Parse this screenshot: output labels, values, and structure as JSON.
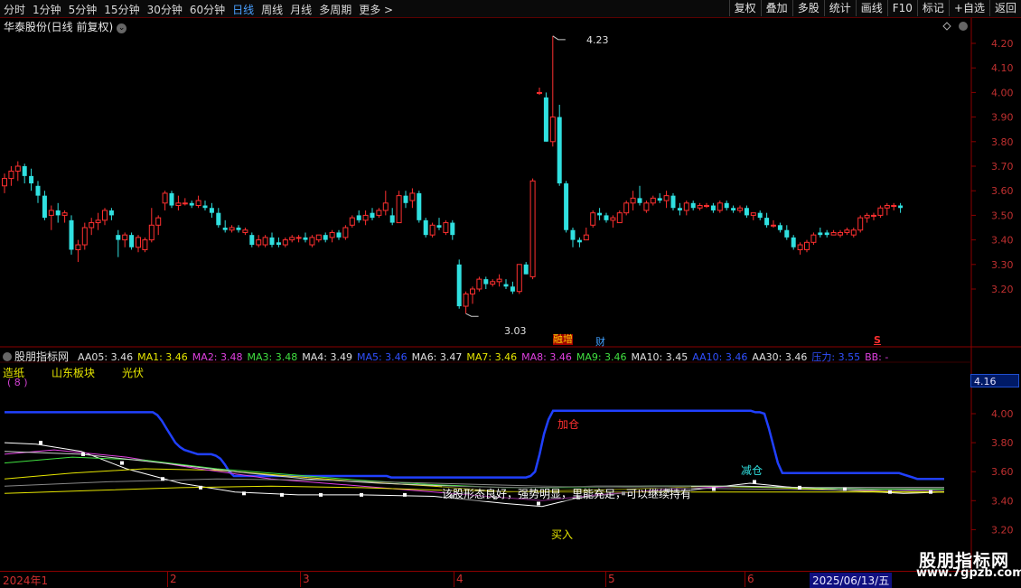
{
  "toolbar": {
    "periods": [
      "分时",
      "1分钟",
      "5分钟",
      "15分钟",
      "30分钟",
      "60分钟",
      "日线",
      "周线",
      "月线",
      "多周期",
      "更多 >"
    ],
    "active": "日线",
    "actions": [
      "复权",
      "叠加",
      "多股",
      "统计",
      "画线",
      "F10",
      "标记",
      "+自选",
      "返回"
    ]
  },
  "title": "华泰股份(日线 前复权)",
  "price_chart": {
    "high_label": "4.23",
    "low_label": "3.03",
    "badge1": "融增",
    "badge2": "财",
    "badge3": "S",
    "axis_ticks": [
      "4.20",
      "4.10",
      "4.00",
      "3.90",
      "3.80",
      "3.70",
      "3.60",
      "3.50",
      "3.40",
      "3.30",
      "3.20"
    ],
    "ohlc": [
      [
        3.62,
        3.67,
        3.59,
        3.65
      ],
      [
        3.65,
        3.7,
        3.62,
        3.68
      ],
      [
        3.68,
        3.72,
        3.64,
        3.7
      ],
      [
        3.7,
        3.71,
        3.63,
        3.66
      ],
      [
        3.66,
        3.69,
        3.6,
        3.63
      ],
      [
        3.62,
        3.64,
        3.55,
        3.58
      ],
      [
        3.58,
        3.6,
        3.48,
        3.49
      ],
      [
        3.5,
        3.54,
        3.44,
        3.52
      ],
      [
        3.52,
        3.55,
        3.47,
        3.5
      ],
      [
        3.5,
        3.52,
        3.47,
        3.51
      ],
      [
        3.48,
        3.5,
        3.34,
        3.36
      ],
      [
        3.36,
        3.4,
        3.31,
        3.38
      ],
      [
        3.38,
        3.47,
        3.36,
        3.45
      ],
      [
        3.45,
        3.49,
        3.42,
        3.47
      ],
      [
        3.47,
        3.51,
        3.44,
        3.48
      ],
      [
        3.48,
        3.53,
        3.46,
        3.52
      ],
      [
        3.52,
        3.53,
        3.48,
        3.5
      ],
      [
        3.42,
        3.44,
        3.33,
        3.4
      ],
      [
        3.4,
        3.43,
        3.37,
        3.42
      ],
      [
        3.42,
        3.43,
        3.36,
        3.37
      ],
      [
        3.37,
        3.42,
        3.35,
        3.41
      ],
      [
        3.36,
        3.41,
        3.35,
        3.4
      ],
      [
        3.4,
        3.53,
        3.39,
        3.46
      ],
      [
        3.46,
        3.5,
        3.42,
        3.49
      ],
      [
        3.55,
        3.6,
        3.52,
        3.59
      ],
      [
        3.59,
        3.6,
        3.53,
        3.54
      ],
      [
        3.54,
        3.58,
        3.52,
        3.55
      ],
      [
        3.55,
        3.57,
        3.54,
        3.55
      ],
      [
        3.55,
        3.56,
        3.53,
        3.54
      ],
      [
        3.54,
        3.58,
        3.53,
        3.56
      ],
      [
        3.54,
        3.56,
        3.52,
        3.53
      ],
      [
        3.53,
        3.55,
        3.49,
        3.51
      ],
      [
        3.51,
        3.53,
        3.45,
        3.46
      ],
      [
        3.45,
        3.48,
        3.43,
        3.44
      ],
      [
        3.44,
        3.46,
        3.43,
        3.45
      ],
      [
        3.45,
        3.46,
        3.43,
        3.44
      ],
      [
        3.43,
        3.45,
        3.42,
        3.44
      ],
      [
        3.42,
        3.43,
        3.37,
        3.38
      ],
      [
        3.38,
        3.42,
        3.37,
        3.4
      ],
      [
        3.38,
        3.42,
        3.37,
        3.41
      ],
      [
        3.41,
        3.43,
        3.37,
        3.38
      ],
      [
        3.39,
        3.41,
        3.37,
        3.38
      ],
      [
        3.38,
        3.41,
        3.37,
        3.4
      ],
      [
        3.4,
        3.42,
        3.39,
        3.41
      ],
      [
        3.41,
        3.42,
        3.39,
        3.41
      ],
      [
        3.41,
        3.43,
        3.39,
        3.4
      ],
      [
        3.38,
        3.42,
        3.37,
        3.41
      ],
      [
        3.4,
        3.42,
        3.39,
        3.42
      ],
      [
        3.42,
        3.43,
        3.39,
        3.4
      ],
      [
        3.41,
        3.44,
        3.39,
        3.43
      ],
      [
        3.43,
        3.44,
        3.4,
        3.41
      ],
      [
        3.41,
        3.46,
        3.4,
        3.45
      ],
      [
        3.46,
        3.5,
        3.45,
        3.49
      ],
      [
        3.5,
        3.52,
        3.47,
        3.48
      ],
      [
        3.48,
        3.52,
        3.46,
        3.5
      ],
      [
        3.51,
        3.53,
        3.48,
        3.49
      ],
      [
        3.5,
        3.53,
        3.49,
        3.52
      ],
      [
        3.52,
        3.6,
        3.5,
        3.55
      ],
      [
        3.5,
        3.53,
        3.46,
        3.47
      ],
      [
        3.47,
        3.6,
        3.47,
        3.58
      ],
      [
        3.58,
        3.6,
        3.53,
        3.55
      ],
      [
        3.56,
        3.61,
        3.53,
        3.59
      ],
      [
        3.59,
        3.6,
        3.47,
        3.48
      ],
      [
        3.48,
        3.49,
        3.41,
        3.42
      ],
      [
        3.42,
        3.47,
        3.41,
        3.46
      ],
      [
        3.46,
        3.49,
        3.44,
        3.45
      ],
      [
        3.43,
        3.48,
        3.42,
        3.47
      ],
      [
        3.47,
        3.48,
        3.4,
        3.42
      ],
      [
        3.3,
        3.32,
        3.12,
        3.13
      ],
      [
        3.13,
        3.19,
        3.1,
        3.18
      ],
      [
        3.18,
        3.21,
        3.14,
        3.2
      ],
      [
        3.2,
        3.25,
        3.19,
        3.24
      ],
      [
        3.24,
        3.25,
        3.2,
        3.22
      ],
      [
        3.22,
        3.24,
        3.21,
        3.23
      ],
      [
        3.23,
        3.26,
        3.21,
        3.24
      ],
      [
        3.22,
        3.24,
        3.2,
        3.21
      ],
      [
        3.21,
        3.23,
        3.18,
        3.19
      ],
      [
        3.19,
        3.3,
        3.18,
        3.3
      ],
      [
        3.3,
        3.31,
        3.26,
        3.26
      ],
      [
        3.25,
        3.65,
        3.24,
        3.64
      ],
      [
        4.0,
        4.02,
        3.99,
        4.0
      ],
      [
        3.98,
        4.0,
        3.8,
        3.8
      ],
      [
        3.8,
        4.23,
        3.78,
        3.9
      ],
      [
        3.9,
        3.95,
        3.62,
        3.63
      ],
      [
        3.63,
        3.64,
        3.43,
        3.44
      ],
      [
        3.44,
        3.45,
        3.37,
        3.4
      ],
      [
        3.4,
        3.41,
        3.37,
        3.39
      ],
      [
        3.4,
        3.45,
        3.4,
        3.42
      ],
      [
        3.46,
        3.52,
        3.45,
        3.51
      ],
      [
        3.51,
        3.53,
        3.48,
        3.5
      ],
      [
        3.5,
        3.51,
        3.47,
        3.48
      ],
      [
        3.48,
        3.5,
        3.45,
        3.49
      ],
      [
        3.47,
        3.52,
        3.47,
        3.51
      ],
      [
        3.51,
        3.56,
        3.5,
        3.55
      ],
      [
        3.55,
        3.6,
        3.52,
        3.57
      ],
      [
        3.57,
        3.62,
        3.54,
        3.55
      ],
      [
        3.52,
        3.56,
        3.51,
        3.55
      ],
      [
        3.55,
        3.58,
        3.54,
        3.57
      ],
      [
        3.57,
        3.59,
        3.55,
        3.56
      ],
      [
        3.56,
        3.6,
        3.53,
        3.58
      ],
      [
        3.58,
        3.59,
        3.52,
        3.53
      ],
      [
        3.53,
        3.55,
        3.5,
        3.52
      ],
      [
        3.52,
        3.56,
        3.5,
        3.55
      ],
      [
        3.55,
        3.56,
        3.52,
        3.53
      ],
      [
        3.53,
        3.55,
        3.52,
        3.54
      ],
      [
        3.54,
        3.55,
        3.53,
        3.54
      ],
      [
        3.54,
        3.55,
        3.51,
        3.52
      ],
      [
        3.52,
        3.56,
        3.51,
        3.55
      ],
      [
        3.55,
        3.56,
        3.52,
        3.53
      ],
      [
        3.53,
        3.54,
        3.51,
        3.52
      ],
      [
        3.52,
        3.54,
        3.51,
        3.53
      ],
      [
        3.53,
        3.54,
        3.49,
        3.5
      ],
      [
        3.5,
        3.51,
        3.48,
        3.51
      ],
      [
        3.51,
        3.52,
        3.48,
        3.49
      ],
      [
        3.49,
        3.51,
        3.45,
        3.46
      ],
      [
        3.46,
        3.48,
        3.45,
        3.46
      ],
      [
        3.46,
        3.47,
        3.43,
        3.44
      ],
      [
        3.44,
        3.46,
        3.4,
        3.41
      ],
      [
        3.41,
        3.42,
        3.36,
        3.37
      ],
      [
        3.36,
        3.39,
        3.34,
        3.38
      ],
      [
        3.36,
        3.4,
        3.35,
        3.39
      ],
      [
        3.39,
        3.43,
        3.38,
        3.42
      ],
      [
        3.43,
        3.45,
        3.41,
        3.42
      ],
      [
        3.43,
        3.44,
        3.41,
        3.42
      ],
      [
        3.42,
        3.44,
        3.42,
        3.43
      ],
      [
        3.42,
        3.44,
        3.41,
        3.43
      ],
      [
        3.43,
        3.45,
        3.42,
        3.44
      ],
      [
        3.42,
        3.45,
        3.41,
        3.44
      ],
      [
        3.44,
        3.5,
        3.43,
        3.49
      ],
      [
        3.49,
        3.51,
        3.47,
        3.5
      ],
      [
        3.5,
        3.51,
        3.48,
        3.5
      ],
      [
        3.5,
        3.54,
        3.49,
        3.53
      ],
      [
        3.53,
        3.55,
        3.5,
        3.54
      ],
      [
        3.54,
        3.55,
        3.52,
        3.54
      ],
      [
        3.54,
        3.55,
        3.51,
        3.53
      ]
    ]
  },
  "indicator_bar": {
    "name": "股朋指标网",
    "items": [
      {
        "text": "AA05: 3.46",
        "color": "#e0e0e0"
      },
      {
        "text": "MA1: 3.46",
        "color": "#e6e600"
      },
      {
        "text": "MA2: 3.48",
        "color": "#e040e0"
      },
      {
        "text": "MA3: 3.48",
        "color": "#40e040"
      },
      {
        "text": "MA4: 3.49",
        "color": "#e0e0e0"
      },
      {
        "text": "MA5: 3.46",
        "color": "#3050ff"
      },
      {
        "text": "MA6: 3.47",
        "color": "#e0e0e0"
      },
      {
        "text": "MA7: 3.46",
        "color": "#e6e600"
      },
      {
        "text": "MA8: 3.46",
        "color": "#e040e0"
      },
      {
        "text": "MA9: 3.46",
        "color": "#40e040"
      },
      {
        "text": "MA10: 3.45",
        "color": "#e0e0e0"
      },
      {
        "text": "AA10: 3.46",
        "color": "#3050ff"
      },
      {
        "text": "AA30: 3.46",
        "color": "#e0e0e0"
      },
      {
        "text": "压力: 3.55",
        "color": "#3050ff"
      },
      {
        "text": "BB: -",
        "color": "#e040e0"
      }
    ]
  },
  "sub_panel": {
    "labels": [
      "造纸",
      "山东板块",
      "光伏"
    ],
    "count": "( 8 )",
    "marker": "4.16",
    "axis_ticks": [
      "4.00",
      "3.80",
      "3.60",
      "3.40",
      "3.20"
    ],
    "add_label": "加仓",
    "reduce_label": "减仓",
    "buy_label": "买入",
    "signal_text": "该股形态良好，强势明显，里能充足，可以继续持有",
    "pressure": [
      4.01,
      4.01,
      4.01,
      4.01,
      4.01,
      4.01,
      4.01,
      4.01,
      4.01,
      4.01,
      4.01,
      4.01,
      4.01,
      4.01,
      4.01,
      4.01,
      4.01,
      4.01,
      4.01,
      4.01,
      4.01,
      4.01,
      4.01,
      4.01,
      4.01,
      4.01,
      4.01,
      4.01,
      4.01,
      4.01,
      4.01,
      4.01,
      4.01,
      4.01,
      3.99,
      3.95,
      3.9,
      3.85,
      3.8,
      3.77,
      3.75,
      3.74,
      3.73,
      3.72,
      3.72,
      3.72,
      3.72,
      3.71,
      3.69,
      3.65,
      3.6,
      3.57,
      3.57,
      3.57,
      3.57,
      3.57,
      3.57,
      3.57,
      3.57,
      3.57,
      3.57,
      3.57,
      3.57,
      3.57,
      3.57,
      3.57,
      3.57,
      3.57,
      3.57,
      3.57,
      3.57,
      3.57,
      3.57,
      3.57,
      3.57,
      3.57,
      3.57,
      3.57,
      3.57,
      3.57,
      3.57,
      3.57,
      3.57,
      3.57,
      3.57,
      3.57,
      3.56,
      3.56,
      3.56,
      3.56,
      3.56,
      3.56,
      3.56,
      3.56,
      3.56,
      3.56,
      3.56,
      3.56,
      3.56,
      3.56,
      3.56,
      3.56,
      3.56,
      3.56,
      3.56,
      3.56,
      3.56,
      3.56,
      3.56,
      3.56,
      3.56,
      3.56,
      3.56,
      3.56,
      3.56,
      3.56,
      3.56,
      3.57,
      3.6,
      3.72,
      3.86,
      3.96,
      4.02,
      4.02,
      4.02,
      4.02,
      4.02,
      4.02,
      4.02,
      4.02,
      4.02,
      4.02,
      4.02,
      4.02,
      4.02,
      4.02,
      4.02,
      4.02,
      4.02,
      4.02,
      4.02,
      4.02,
      4.02,
      4.02,
      4.02,
      4.02,
      4.02,
      4.02,
      4.02,
      4.02,
      4.02,
      4.02,
      4.02,
      4.02,
      4.02,
      4.02,
      4.02,
      4.02,
      4.02,
      4.02,
      4.02,
      4.02,
      4.02,
      4.02,
      4.02,
      4.02,
      4.02,
      4.01,
      4.01,
      4.0,
      3.9,
      3.78,
      3.66,
      3.59,
      3.59,
      3.59,
      3.59,
      3.59,
      3.59,
      3.59,
      3.59,
      3.59,
      3.59,
      3.59,
      3.59,
      3.59,
      3.59,
      3.59,
      3.59,
      3.59,
      3.59,
      3.59,
      3.59,
      3.59,
      3.59,
      3.59,
      3.59,
      3.59,
      3.59,
      3.59,
      3.58,
      3.57,
      3.56,
      3.55,
      3.55,
      3.55,
      3.55,
      3.55,
      3.55,
      3.55
    ]
  },
  "date_axis": {
    "labels": [
      "2024年1",
      "2",
      "3",
      "4",
      "5",
      "6"
    ],
    "current": "2025/06/13/五"
  },
  "colors": {
    "up": "#ff3030",
    "down": "#30e0e0",
    "grid": "#5a0000",
    "axis_text": "#c03030"
  },
  "watermark": {
    "cn": "股朋指标网",
    "url": "www.7gpzb.com"
  }
}
